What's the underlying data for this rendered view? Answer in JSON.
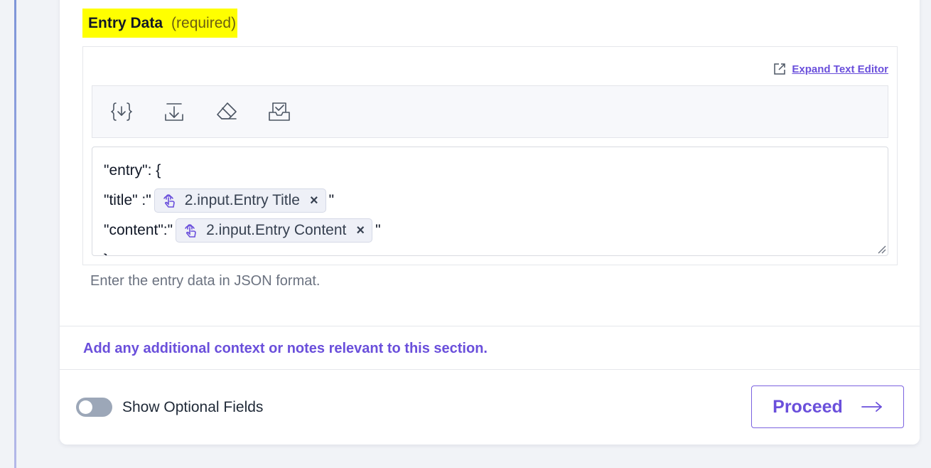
{
  "field": {
    "label": "Entry Data",
    "required_text": "(required)",
    "help_text": "Enter the entry data in JSON format."
  },
  "editor": {
    "expand_link": "Expand Text Editor",
    "toolbar_icons": [
      "insert-variable-icon",
      "download-icon",
      "eraser-icon",
      "inbox-check-icon"
    ],
    "lines": [
      {
        "prefix": "\"entry\": {"
      },
      {
        "prefix": "\"title\" :\"",
        "pill": "2.input.Entry Title",
        "suffix": "\""
      },
      {
        "prefix": "\"content\":\"",
        "pill": "2.input.Entry Content",
        "suffix": "\""
      },
      {
        "prefix": "}"
      }
    ]
  },
  "notes_link": "Add any additional context or notes relevant to this section.",
  "footer": {
    "toggle_label": "Show Optional Fields",
    "toggle_on": false,
    "proceed_label": "Proceed"
  },
  "colors": {
    "accent": "#6a4fdb",
    "highlight": "#ffff00"
  }
}
